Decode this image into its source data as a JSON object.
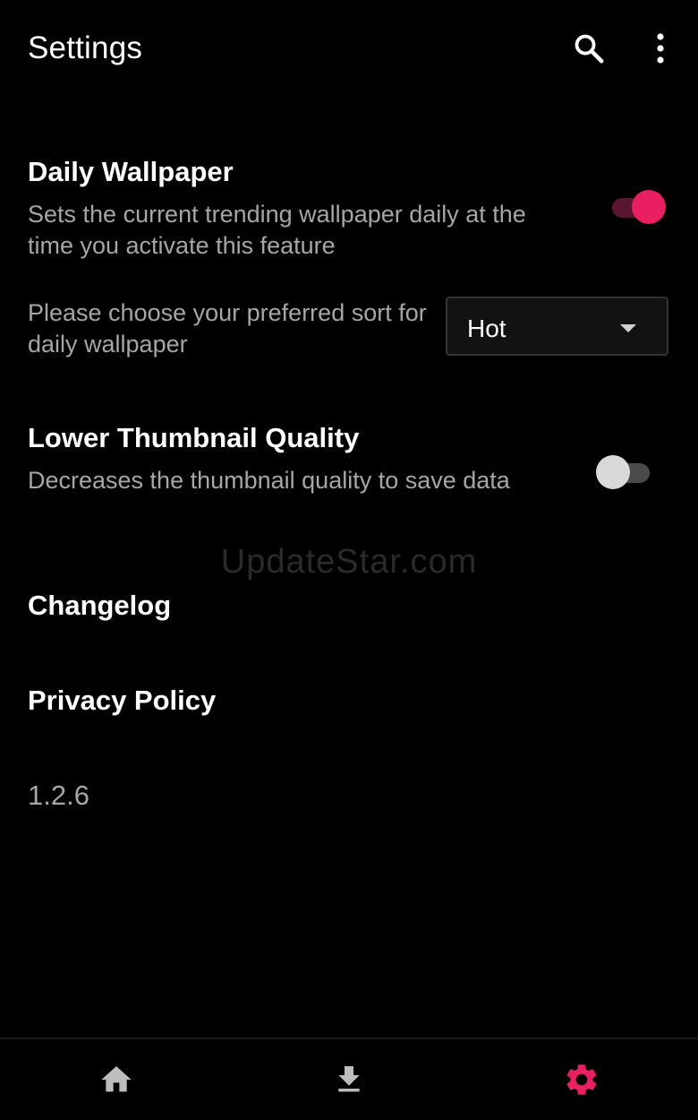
{
  "header": {
    "title": "Settings"
  },
  "settings": {
    "daily_wallpaper": {
      "title": "Daily Wallpaper",
      "description": "Sets the current trending wallpaper daily at the time you activate this feature",
      "enabled": true
    },
    "sort_preference": {
      "label": "Please choose your preferred sort for daily wallpaper",
      "selected": "Hot"
    },
    "lower_thumbnail_quality": {
      "title": "Lower Thumbnail Quality",
      "description": "Decreases the thumbnail quality to save data",
      "enabled": false
    },
    "changelog_label": "Changelog",
    "privacy_policy_label": "Privacy Policy",
    "version": "1.2.6"
  },
  "watermark": "UpdateStar.com",
  "bottom_nav": {
    "items": [
      {
        "icon": "home-icon",
        "active": false
      },
      {
        "icon": "download-icon",
        "active": false
      },
      {
        "icon": "gear-icon",
        "active": true
      }
    ]
  },
  "colors": {
    "background": "#000000",
    "accent": "#e91e63",
    "text_primary": "#ffffff",
    "text_secondary": "#a6a6a6",
    "icon_inactive": "#bdbdbd"
  }
}
